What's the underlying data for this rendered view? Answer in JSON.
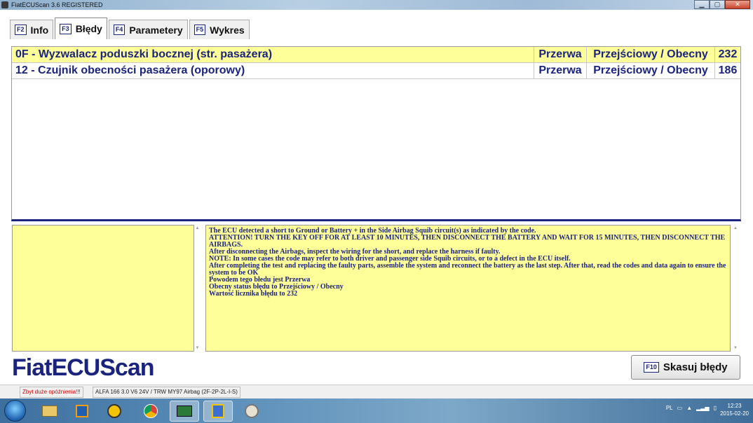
{
  "window": {
    "title": "FiatECUScan 3.6 REGISTERED"
  },
  "tabs": [
    {
      "key": "F2",
      "label": "Info"
    },
    {
      "key": "F3",
      "label": "Błędy"
    },
    {
      "key": "F4",
      "label": "Parametery"
    },
    {
      "key": "F5",
      "label": "Wykres"
    }
  ],
  "errors": [
    {
      "code": "0F - Wyzwalacz poduszki bocznej (str. pasażera)",
      "type": "Przerwa",
      "status": "Przejściowy / Obecny",
      "count": "232"
    },
    {
      "code": "12 - Czujnik obecności pasażera (oporowy)",
      "type": "Przerwa",
      "status": "Przejściowy / Obecny",
      "count": "186"
    }
  ],
  "description": [
    "The ECU detected a short to Ground or Battery + in the Side Airbag Squib circuit(s) as indicated by the code.",
    "ATTENTION! TURN THE KEY OFF FOR AT LEAST 10 MINUTES, THEN DISCONNECT THE BATTERY AND WAIT FOR 15 MINUTES, THEN DISCONNECT THE AIRBAGS.",
    "After disconnecting the Airbags, inspect the wiring for the short, and replace the harness if faulty.",
    "NOTE: In some cases the code may refer to both driver and passenger side Squib circuits, or to a defect in the ECU itself.",
    "After completing the test and replacing the faulty parts, assemble the system and reconnect the battery as the last step. After that, read the codes and data again to ensure the system to be OK",
    "Powodem tego błedu jest Przerwa",
    "Obecny status błędu to Przejściowy / Obecny",
    "Wartość licznika błędu to 232"
  ],
  "logo": "FiatECUScan",
  "clear_button": {
    "key": "F10",
    "label": "Skasuj błędy"
  },
  "status": {
    "warning": "Zbyt duże opóźnienia!!!",
    "vehicle": "ALFA 166 3.0 V6 24V / TRW MY97 Airbag (2F-2P-2L-I-S)"
  },
  "tray": {
    "lang": "PL",
    "time": "12:23",
    "date": "2015-02-20"
  },
  "colors": {
    "accent": "#1a237e",
    "highlight": "#ffff99",
    "warning": "#cc0000"
  }
}
